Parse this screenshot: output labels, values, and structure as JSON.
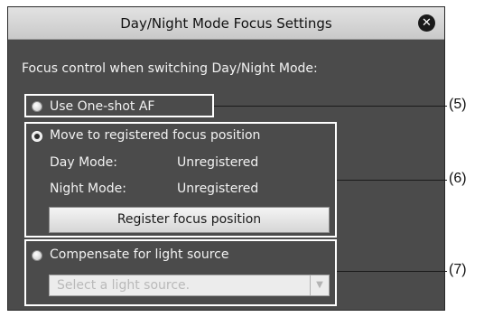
{
  "dialog": {
    "title": "Day/Night Mode Focus Settings",
    "close_glyph": "✕",
    "prompt": "Focus control when switching Day/Night Mode:"
  },
  "options": {
    "one_shot_af": {
      "label": "Use One-shot AF",
      "selected": false
    },
    "registered_focus": {
      "label": "Move to registered focus position",
      "selected": true,
      "day_label": "Day Mode:",
      "day_value": "Unregistered",
      "night_label": "Night Mode:",
      "night_value": "Unregistered",
      "register_button": "Register focus position"
    },
    "compensate": {
      "label": "Compensate for light source",
      "selected": false,
      "select_placeholder": "Select a light source.",
      "select_arrow": "▼"
    }
  },
  "callouts": [
    "(5)",
    "(6)",
    "(7)"
  ],
  "icons": {
    "close": "close-icon",
    "dropdown": "dropdown-arrow-icon"
  },
  "colors": {
    "dialog_bg": "#4b4b4b",
    "titlebar": "#d6d6d6",
    "outline": "#ffffff"
  }
}
